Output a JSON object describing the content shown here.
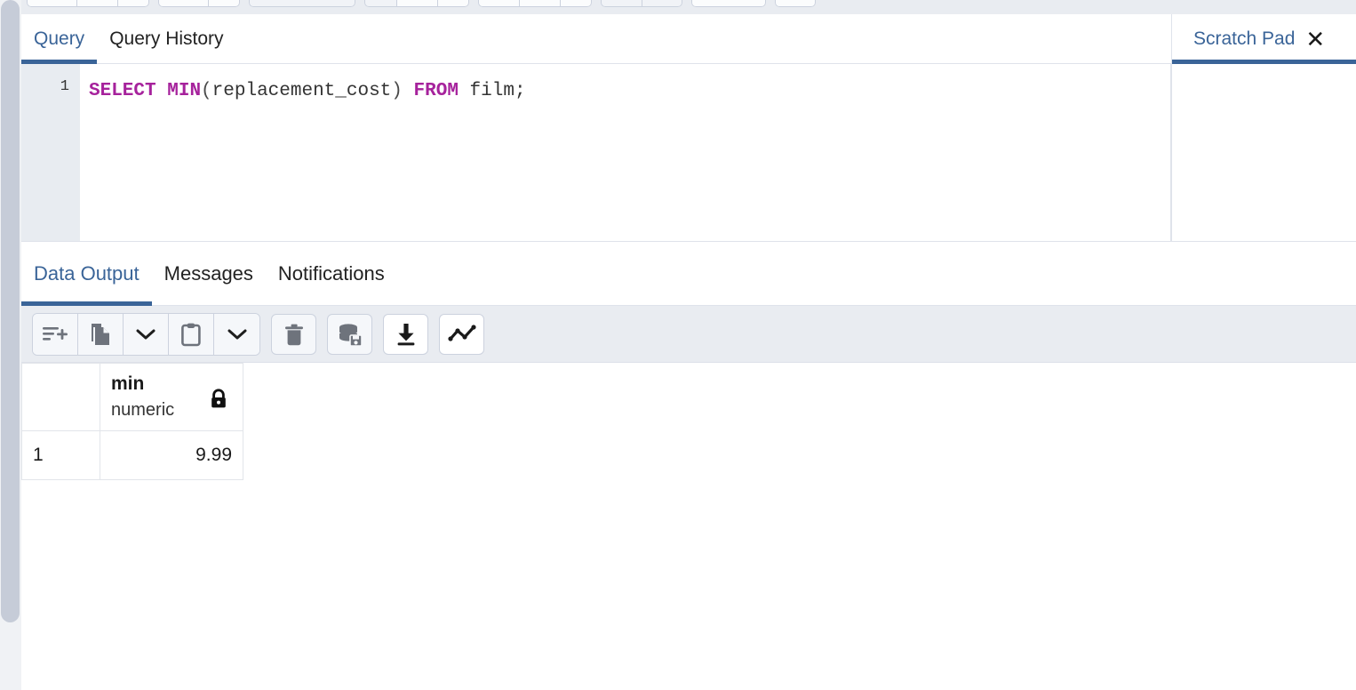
{
  "top_toolbar": {
    "groups": [
      {
        "buttons": [
          "open-file",
          "save-file",
          "save-as"
        ]
      },
      {
        "buttons": [
          "edit-undo",
          "edit-redo"
        ]
      },
      {
        "buttons": [
          "filter-rows",
          "filter-options"
        ]
      },
      {
        "buttons": [
          "limit-selector"
        ]
      },
      {
        "buttons": [
          "execute-query",
          "explain",
          "explain-analyze"
        ]
      },
      {
        "buttons": [
          "commit",
          "rollback",
          "auto-commit"
        ]
      },
      {
        "buttons": [
          "macros",
          "macro-manage"
        ]
      },
      {
        "buttons": [
          "clear-editor"
        ]
      },
      {
        "buttons": [
          "query-tool-menu"
        ]
      }
    ]
  },
  "query_panel": {
    "tabs": [
      {
        "label": "Query",
        "active": true
      },
      {
        "label": "Query History",
        "active": false
      }
    ],
    "editor": {
      "line_numbers": [
        "1"
      ],
      "sql_tokens": [
        {
          "text": "SELECT",
          "kind": "keyword"
        },
        {
          "text": " ",
          "kind": "plain"
        },
        {
          "text": "MIN",
          "kind": "keyword"
        },
        {
          "text": "(",
          "kind": "punct"
        },
        {
          "text": "replacement_cost",
          "kind": "ident"
        },
        {
          "text": ")",
          "kind": "punct"
        },
        {
          "text": " ",
          "kind": "plain"
        },
        {
          "text": "FROM",
          "kind": "keyword"
        },
        {
          "text": " ",
          "kind": "plain"
        },
        {
          "text": "film;",
          "kind": "ident"
        }
      ],
      "sql_text": "SELECT MIN(replacement_cost) FROM film;"
    }
  },
  "scratch_pad": {
    "tab_label": "Scratch Pad",
    "close_glyph": "✕",
    "content": ""
  },
  "output_panel": {
    "tabs": [
      {
        "label": "Data Output",
        "active": true
      },
      {
        "label": "Messages",
        "active": false
      },
      {
        "label": "Notifications",
        "active": false
      }
    ],
    "toolbar": {
      "buttons": [
        {
          "name": "add-row-icon",
          "style": "group"
        },
        {
          "name": "copy-icon",
          "style": "group"
        },
        {
          "name": "copy-options-chevron-down-icon",
          "style": "group"
        },
        {
          "name": "paste-icon",
          "style": "group"
        },
        {
          "name": "paste-options-chevron-down-icon",
          "style": "group"
        },
        {
          "name": "delete-row-trash-icon",
          "style": "solo"
        },
        {
          "name": "save-data-changes-icon",
          "style": "solo"
        },
        {
          "name": "download-results-icon",
          "style": "white"
        },
        {
          "name": "graph-visualiser-icon",
          "style": "white"
        }
      ]
    },
    "grid": {
      "columns": [
        {
          "name": "min",
          "type": "numeric",
          "locked": true
        }
      ],
      "rows": [
        {
          "row_number": "1",
          "values": [
            "9.99"
          ]
        }
      ]
    }
  },
  "colors": {
    "accent_blue": "#3a6498",
    "keyword_magenta": "#a6229c",
    "toolbar_bg": "#e9ecf1",
    "gutter_bg": "#e8ecf1",
    "border": "#dfe3eb",
    "scrollbar_thumb": "#c6ccd8"
  }
}
